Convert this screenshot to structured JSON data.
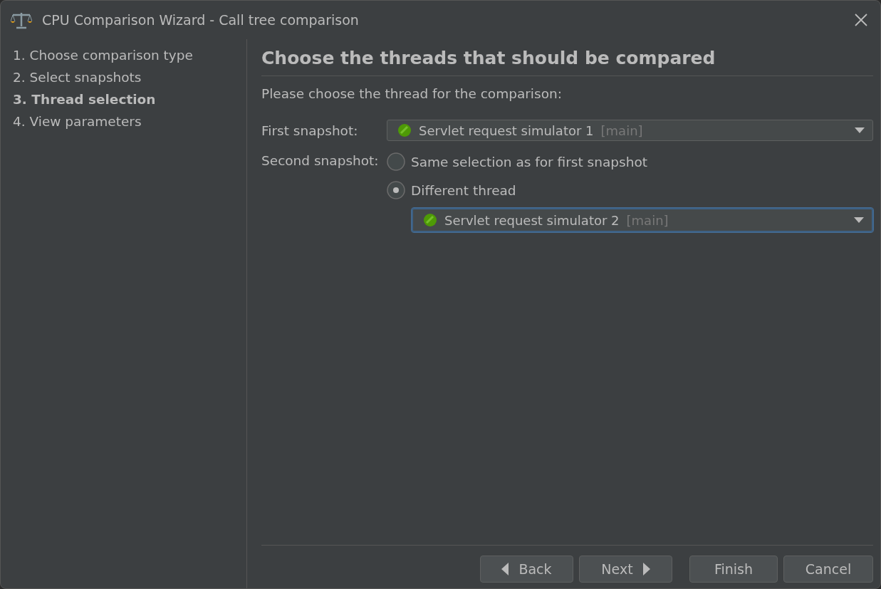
{
  "window": {
    "title": "CPU Comparison Wizard - Call tree comparison"
  },
  "steps": [
    {
      "label": "1. Choose comparison type",
      "selected": false
    },
    {
      "label": "2. Select snapshots",
      "selected": false
    },
    {
      "label": "3. Thread selection",
      "selected": true
    },
    {
      "label": "4. View parameters",
      "selected": false
    }
  ],
  "heading": "Choose the threads that should be compared",
  "instruction": "Please choose the thread for the comparison:",
  "first_snapshot": {
    "label": "First snapshot:",
    "thread": "Servlet request simulator 1",
    "group": "[main]",
    "focused": false
  },
  "second_snapshot": {
    "label": "Second snapshot:",
    "options": [
      {
        "label": "Same selection as for first snapshot",
        "selected": false
      },
      {
        "label": "Different thread",
        "selected": true
      }
    ],
    "thread": "Servlet request simulator 2",
    "group": "[main]",
    "focused": true
  },
  "buttons": [
    {
      "label": "Back",
      "kind": "back"
    },
    {
      "label": "Next",
      "kind": "next"
    },
    {
      "label": "Finish",
      "kind": "plain"
    },
    {
      "label": "Cancel",
      "kind": "plain"
    }
  ]
}
